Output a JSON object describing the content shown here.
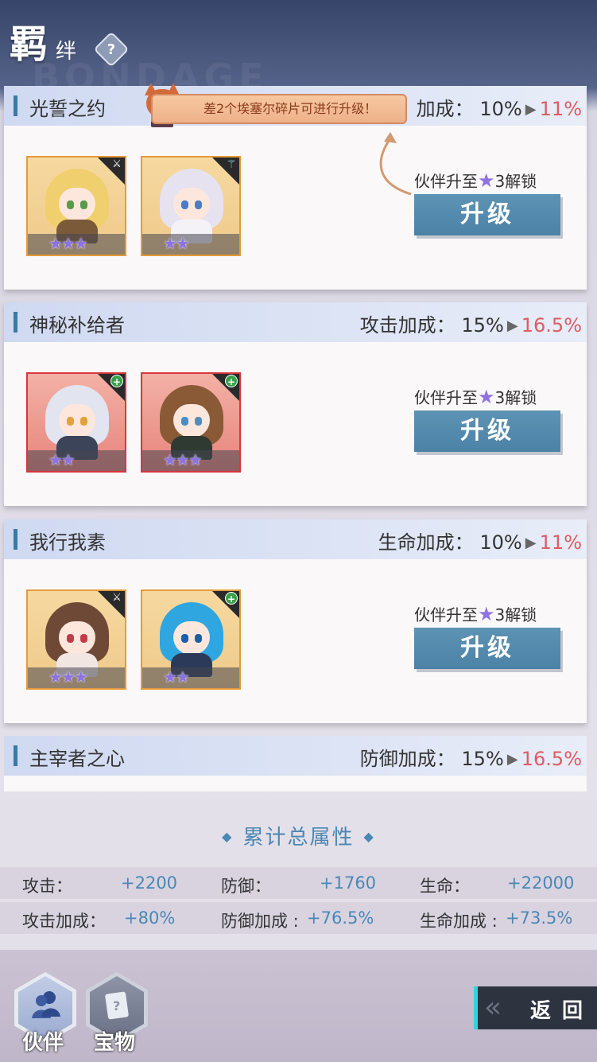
{
  "header": {
    "title": "羁",
    "subtitle": "绊",
    "help": "?",
    "watermark": "BONDAGE"
  },
  "tooltip": {
    "text": "差2个埃塞尔碎片可进行升级！"
  },
  "bonds": [
    {
      "name": "光誓之约",
      "bonus_label": "加成：",
      "old": "10%",
      "new": "11%",
      "unlock_prefix": "伙伴升至",
      "unlock_suffix": "3解锁",
      "button": "升级",
      "partners": [
        {
          "bg": "orange",
          "role": "attack-role-icon",
          "stars": "★★★"
        },
        {
          "bg": "orange",
          "role": "mage-role-icon",
          "stars": "★★"
        }
      ]
    },
    {
      "name": "神秘补给者",
      "bonus_label": "攻击加成：",
      "old": "15%",
      "new": "16.5%",
      "unlock_prefix": "伙伴升至",
      "unlock_suffix": "3解锁",
      "button": "升级",
      "partners": [
        {
          "bg": "red",
          "role": "heal-role-icon",
          "stars": "★★"
        },
        {
          "bg": "red",
          "role": "heal-role-icon",
          "stars": "★★★"
        }
      ]
    },
    {
      "name": "我行我素",
      "bonus_label": "生命加成：",
      "old": "10%",
      "new": "11%",
      "unlock_prefix": "伙伴升至",
      "unlock_suffix": "3解锁",
      "button": "升级",
      "partners": [
        {
          "bg": "orange",
          "role": "attack-role-icon",
          "stars": "★★★"
        },
        {
          "bg": "orange",
          "role": "heal-role-icon",
          "stars": "★★"
        }
      ]
    },
    {
      "name": "主宰者之心",
      "bonus_label": "防御加成：",
      "old": "15%",
      "new": "16.5%"
    }
  ],
  "totals": {
    "title": "累计总属性",
    "row1": [
      {
        "label": "攻击：",
        "value": "+2200"
      },
      {
        "label": "防御：",
        "value": "+1760"
      },
      {
        "label": "生命：",
        "value": "+22000"
      }
    ],
    "row2": [
      {
        "label": "攻击加成：",
        "value": "+80%"
      },
      {
        "label": "防御加成 :",
        "value": "+76.5%"
      },
      {
        "label": "生命加成 :",
        "value": "+73.5%"
      }
    ]
  },
  "nav": {
    "partner": "伙伴",
    "treasure": "宝物",
    "back": "返回"
  },
  "colors": {
    "accent": "#4b87b4",
    "new_value": "#e05b63",
    "star": "#8c72e2"
  }
}
